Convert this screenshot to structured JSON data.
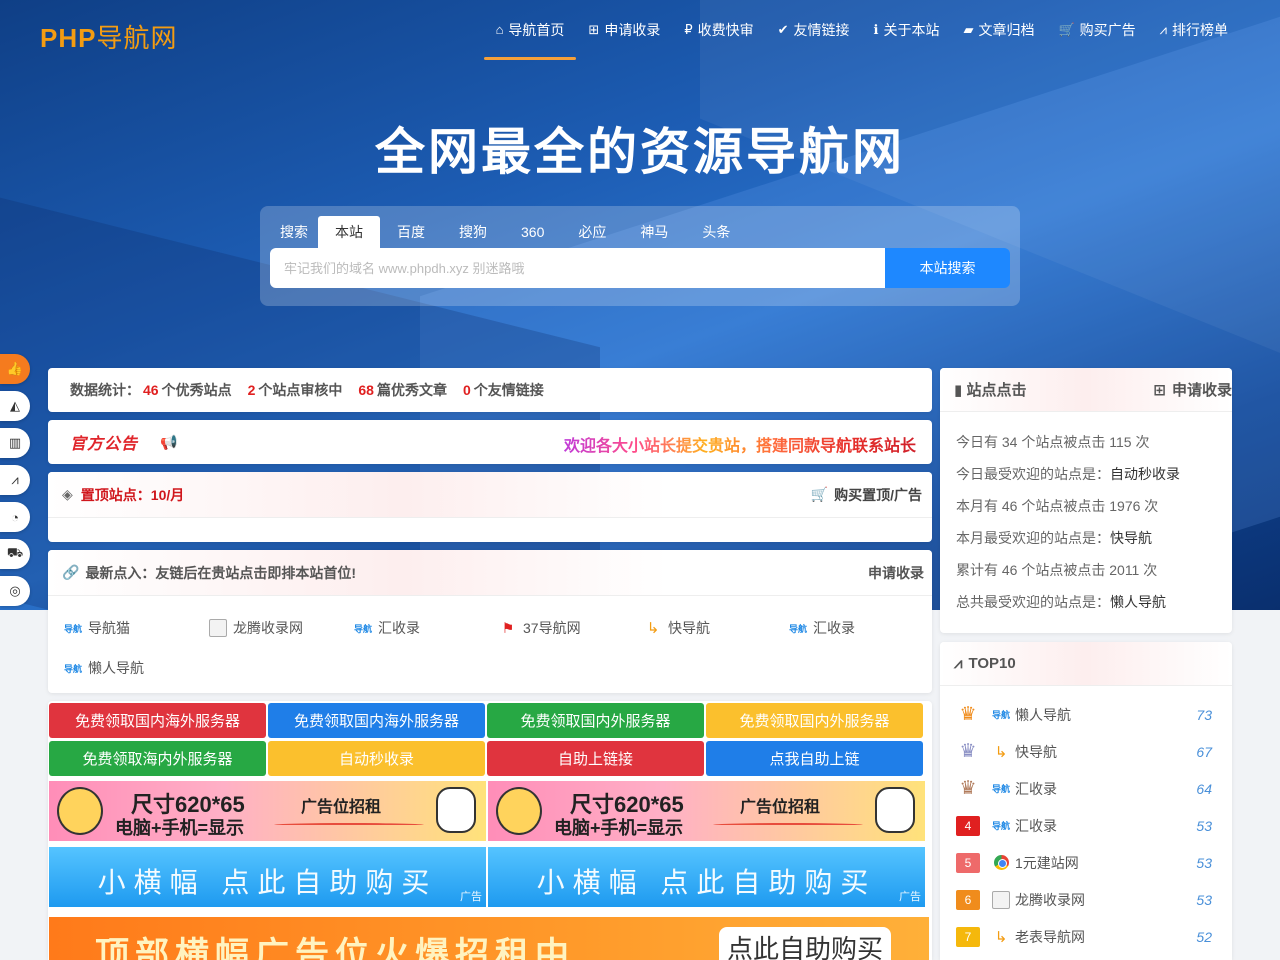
{
  "logo": {
    "en": "PHP",
    "cn": "导航网"
  },
  "nav": [
    {
      "label": "导航首页",
      "icon": "home-icon",
      "glyph": "⌂"
    },
    {
      "label": "申请收录",
      "icon": "plus-square-icon",
      "glyph": "⊞"
    },
    {
      "label": "收费快审",
      "icon": "rupee-icon",
      "glyph": "₽"
    },
    {
      "label": "友情链接",
      "icon": "check-icon",
      "glyph": "✔"
    },
    {
      "label": "关于本站",
      "icon": "info-icon",
      "glyph": "ℹ"
    },
    {
      "label": "文章归档",
      "icon": "folder-icon",
      "glyph": "▰"
    },
    {
      "label": "购买广告",
      "icon": "cart-icon",
      "glyph": "🛒"
    },
    {
      "label": "排行榜单",
      "icon": "chart-icon",
      "glyph": "⩘"
    }
  ],
  "hero": {
    "title": "全网最全的资源导航网"
  },
  "search": {
    "tabs": [
      "搜索",
      "本站",
      "百度",
      "搜狗",
      "360",
      "必应",
      "神马",
      "头条"
    ],
    "active_tab": "本站",
    "placeholder": "牢记我们的域名 www.phpdh.xyz 别迷路哦",
    "button": "本站搜索"
  },
  "stats": {
    "label": "数据统计：",
    "sites": "46",
    "sites_label": "个优秀站点",
    "review": "2",
    "review_label": "个站点审核中",
    "articles": "68",
    "articles_label": "篇优秀文章",
    "links": "0",
    "links_label": "个友情链接"
  },
  "notice": {
    "badge": "官方公告",
    "text": "欢迎各大小站长提交贵站，搭建同款导航联系站长"
  },
  "pinned": {
    "title": "置顶站点：10/月",
    "buy": "购买置顶/广告"
  },
  "latest": {
    "title": "最新点入：友链后在贵站点击即排本站首位!",
    "apply": "申请收录",
    "items": [
      {
        "name": "导航猫",
        "icon": "nav"
      },
      {
        "name": "龙腾收录网",
        "icon": "box"
      },
      {
        "name": "汇收录",
        "icon": "nav"
      },
      {
        "name": "37导航网",
        "icon": "red"
      },
      {
        "name": "快导航",
        "icon": "orange"
      },
      {
        "name": "汇收录",
        "icon": "nav"
      },
      {
        "name": "懒人导航",
        "icon": "nav"
      }
    ]
  },
  "ads": {
    "buttons": [
      {
        "label": "免费领取国内海外服务器",
        "color": "red"
      },
      {
        "label": "免费领取国内海外服务器",
        "color": "blue"
      },
      {
        "label": "免费领取国内外服务器",
        "color": "green"
      },
      {
        "label": "免费领取国内外服务器",
        "color": "yellow"
      },
      {
        "label": "免费领取海内外服务器",
        "color": "green"
      },
      {
        "label": "自动秒收录",
        "color": "yellow"
      },
      {
        "label": "自助上链接",
        "color": "red"
      },
      {
        "label": "点我自助上链",
        "color": "blue"
      }
    ],
    "pink_banner": {
      "size": "尺寸620*65",
      "device": "电脑+手机=显示",
      "recruit": "广告位招租"
    },
    "blue_banner": {
      "text": "小横幅 点此自助购买",
      "tag": "广告"
    },
    "orange_banner": {
      "text": "顶部横幅广告位火爆招租中……",
      "button": "点此自助购买"
    }
  },
  "site_clicks": {
    "title": "站点点击",
    "apply": "申请收录",
    "lines": [
      {
        "text": "今日有 34 个站点被点击 115 次",
        "strong": ""
      },
      {
        "text": "今日最受欢迎的站点是：",
        "strong": "自动秒收录"
      },
      {
        "text": "本月有 46 个站点被点击 1976 次",
        "strong": ""
      },
      {
        "text": "本月最受欢迎的站点是：",
        "strong": "快导航"
      },
      {
        "text": "累计有 46 个站点被点击 2011 次",
        "strong": ""
      },
      {
        "text": "总共最受欢迎的站点是：",
        "strong": "懒人导航"
      }
    ]
  },
  "top10": {
    "title": "TOP10",
    "rows": [
      {
        "rank": "1",
        "name": "懒人导航",
        "count": "73",
        "icon": "nav"
      },
      {
        "rank": "2",
        "name": "快导航",
        "count": "67",
        "icon": "orange"
      },
      {
        "rank": "3",
        "name": "汇收录",
        "count": "64",
        "icon": "nav"
      },
      {
        "rank": "4",
        "name": "汇收录",
        "count": "53",
        "icon": "nav"
      },
      {
        "rank": "5",
        "name": "1元建站网",
        "count": "53",
        "icon": "chrome"
      },
      {
        "rank": "6",
        "name": "龙腾收录网",
        "count": "53",
        "icon": "box"
      },
      {
        "rank": "7",
        "name": "老表导航网",
        "count": "52",
        "icon": "orange"
      }
    ]
  },
  "side_toolbar": [
    "thumbs-up-icon",
    "area-chart-icon",
    "bar-chart-icon",
    "line-chart-icon",
    "pie-chart-icon",
    "truck-icon",
    "coin-icon"
  ]
}
